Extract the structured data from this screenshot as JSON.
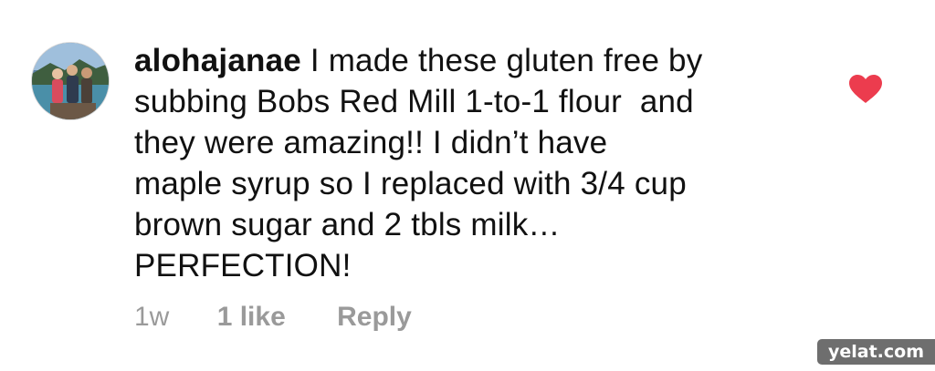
{
  "comment": {
    "username": "alohajanae",
    "text_lines": [
      " I made these gluten free by",
      "subbing Bobs Red Mill 1-to-1 flour  and",
      "they were amazing!! I didn’t have",
      "maple syrup so I replaced with 3/4 cup",
      "brown sugar and 2 tbls milk…",
      "PERFECTION!"
    ],
    "liked": true,
    "like_icon": "heart-icon"
  },
  "meta": {
    "time": "1w",
    "likes": "1 like",
    "reply": "Reply"
  },
  "watermark": "yelat.com",
  "colors": {
    "heart": "#ec3c4e",
    "meta_text": "#9a9a9a",
    "watermark_bg": "#6e6e6e"
  }
}
